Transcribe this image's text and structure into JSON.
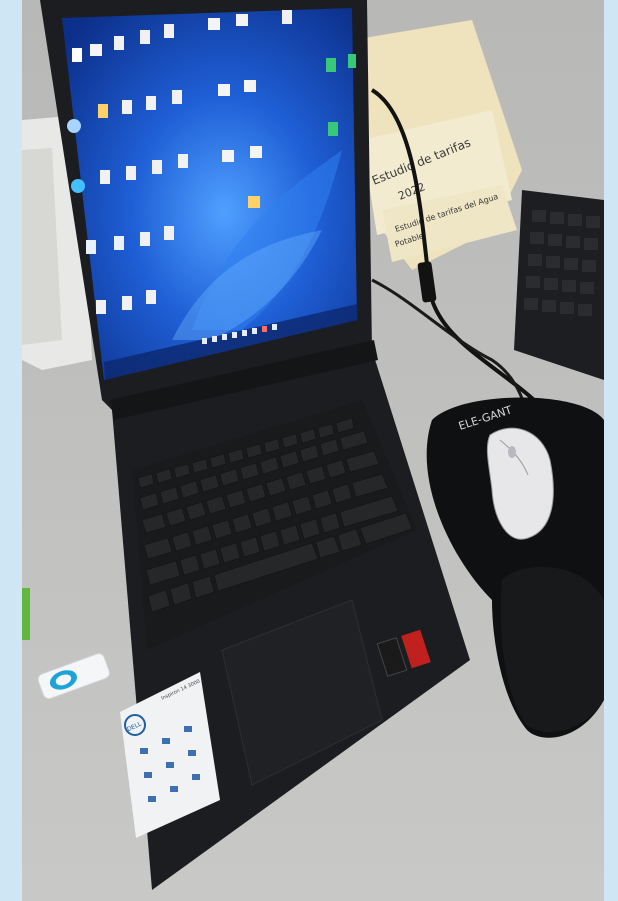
{
  "colors": {
    "frame_bg": "#cfe6f4",
    "desk": "#bfbfbd",
    "laptop_body": "#1c1d20",
    "screen_blue": "#1f5fd6",
    "keyboard_keys": "#202124",
    "sticker_bg": "#f0f2f4",
    "mousepad": "#0f1011",
    "usb_blue": "#1ea3d8"
  },
  "paper_notes": {
    "line_1": "Estudio de tarifas",
    "line_2": "2022",
    "line_3": "Estudio de tarifas del Agua",
    "line_4": "Potable"
  },
  "mousepad": {
    "brand": "ELE-GANT"
  },
  "laptop": {
    "sticker_model": "Inspiron 14 3000",
    "logo": "DELL"
  },
  "icons": [
    "desktop-icon",
    "folder-icon",
    "file-icon",
    "recycle-bin-icon",
    "edge-icon",
    "mouse-icon",
    "usb-icon"
  ]
}
